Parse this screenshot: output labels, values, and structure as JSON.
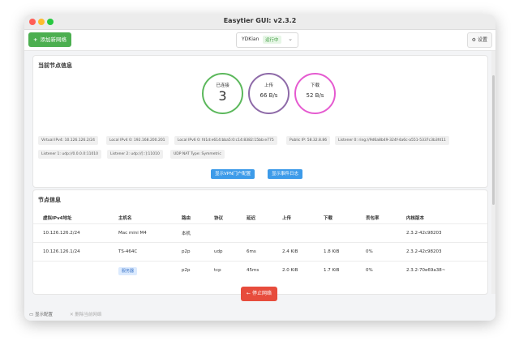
{
  "window": {
    "title": "Easytier GUI: v2.3.2"
  },
  "toolbar": {
    "add_network": "添加新网络",
    "network_name": "YDKian",
    "network_status": "运行中",
    "settings": "设置"
  },
  "node_info": {
    "title": "当前节点信息",
    "connected_label": "已连接",
    "connected_value": "3",
    "upload_label": "上传",
    "upload_value": "66 B/s",
    "download_label": "下载",
    "download_value": "52 B/s",
    "chips": [
      "Virtual IPv4: 10.126.126.2/24",
      "Local IPv4 0: 192.168.200.201",
      "Local IPv6 0: fd1d:e614:bba5:0:c14:8382:15bb:e775",
      "Public IP: 58.32.8.86",
      "Listener 0: ring://9d6a8b49-324f-4a6c-a551-5337c3b3fd11",
      "Listener 1: udp://0.0.0.0:11010",
      "Listener 2: udp://[::]:11010",
      "UDP NAT Type: Symmetric"
    ],
    "vpn_button": "显示VPN门户配置",
    "events_button": "显示事件日志"
  },
  "peers": {
    "title": "节点信息",
    "columns": [
      "虚拟IPv4地址",
      "主机名",
      "路由",
      "协议",
      "延迟",
      "上传",
      "下载",
      "丢包率",
      "内核版本"
    ],
    "rows": [
      [
        "10.126.126.2/24",
        "Mac mini M4",
        "本机",
        "",
        "",
        "",
        "",
        "",
        "2.3.2-42c98203"
      ],
      [
        "10.126.126.1/24",
        "TS-464C",
        "p2p",
        "udp",
        "6ms",
        "2.4 KiB",
        "1.8 KiB",
        "0%",
        "2.3.2-42c98203"
      ],
      [
        "",
        "服务器",
        "p2p",
        "tcp",
        "45ms",
        "2.0 KiB",
        "1.7 KiB",
        "0%",
        "2.3.2-70e69a38~"
      ]
    ]
  },
  "actions": {
    "stop": "停止网络",
    "show_config": "显示配置",
    "delete_network": "删除当前网络"
  }
}
